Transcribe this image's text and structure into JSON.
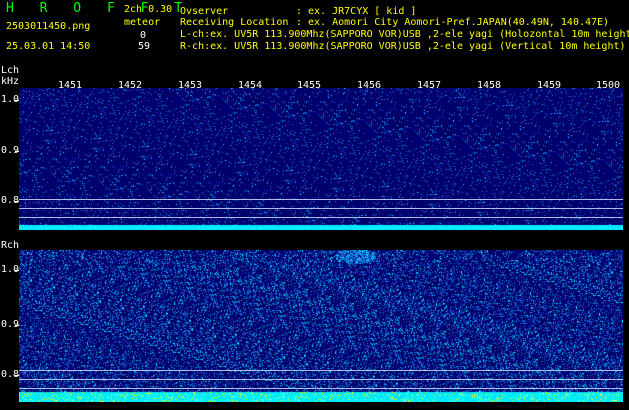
{
  "header": {
    "app_title": "H R O F F T",
    "filename": "2503011450.png",
    "datetime": "25.03.01 14:50",
    "channel_label": "2ch 0.30",
    "meteor_label": "meteor",
    "meteor_l_count": "0",
    "meteor_r_count": "59"
  },
  "info": {
    "observer_key": "Ovserver",
    "observer_value": ": ex. JR7CYX [ kid ]",
    "location_key": "Receiving Location",
    "location_value": ": ex. Aomori City Aomori-Pref.JAPAN(40.49N, 140.47E)",
    "lch_line": "L-ch:ex. UV5R 113.900Mhz(SAPPORO VOR)USB ,2-ele yagi (Holozontal 10m height",
    "rch_line": "R-ch:ex. UV5R 113.900Mhz(SAPPORO VOR)USB ,2-ele yagi (Vertical 10m height)"
  },
  "axis": {
    "lch_label": "Lch",
    "khz_label": "kHz",
    "rch_label": "Rch",
    "time_ticks": [
      "1451",
      "1452",
      "1453",
      "1454",
      "1455",
      "1456",
      "1457",
      "1458",
      "1459",
      "1500"
    ],
    "lch_freq_ticks": [
      "1.0",
      "0.9",
      "0.8"
    ],
    "rch_freq_ticks": [
      "1.0",
      "0.9",
      "0.8"
    ]
  },
  "colors": {
    "background": "#000000",
    "title": "#00ff00",
    "highlight": "#ffff00",
    "text": "#ffffff",
    "spectrum_base": "#00107a",
    "spectrum_noise": "#00ffff"
  }
}
